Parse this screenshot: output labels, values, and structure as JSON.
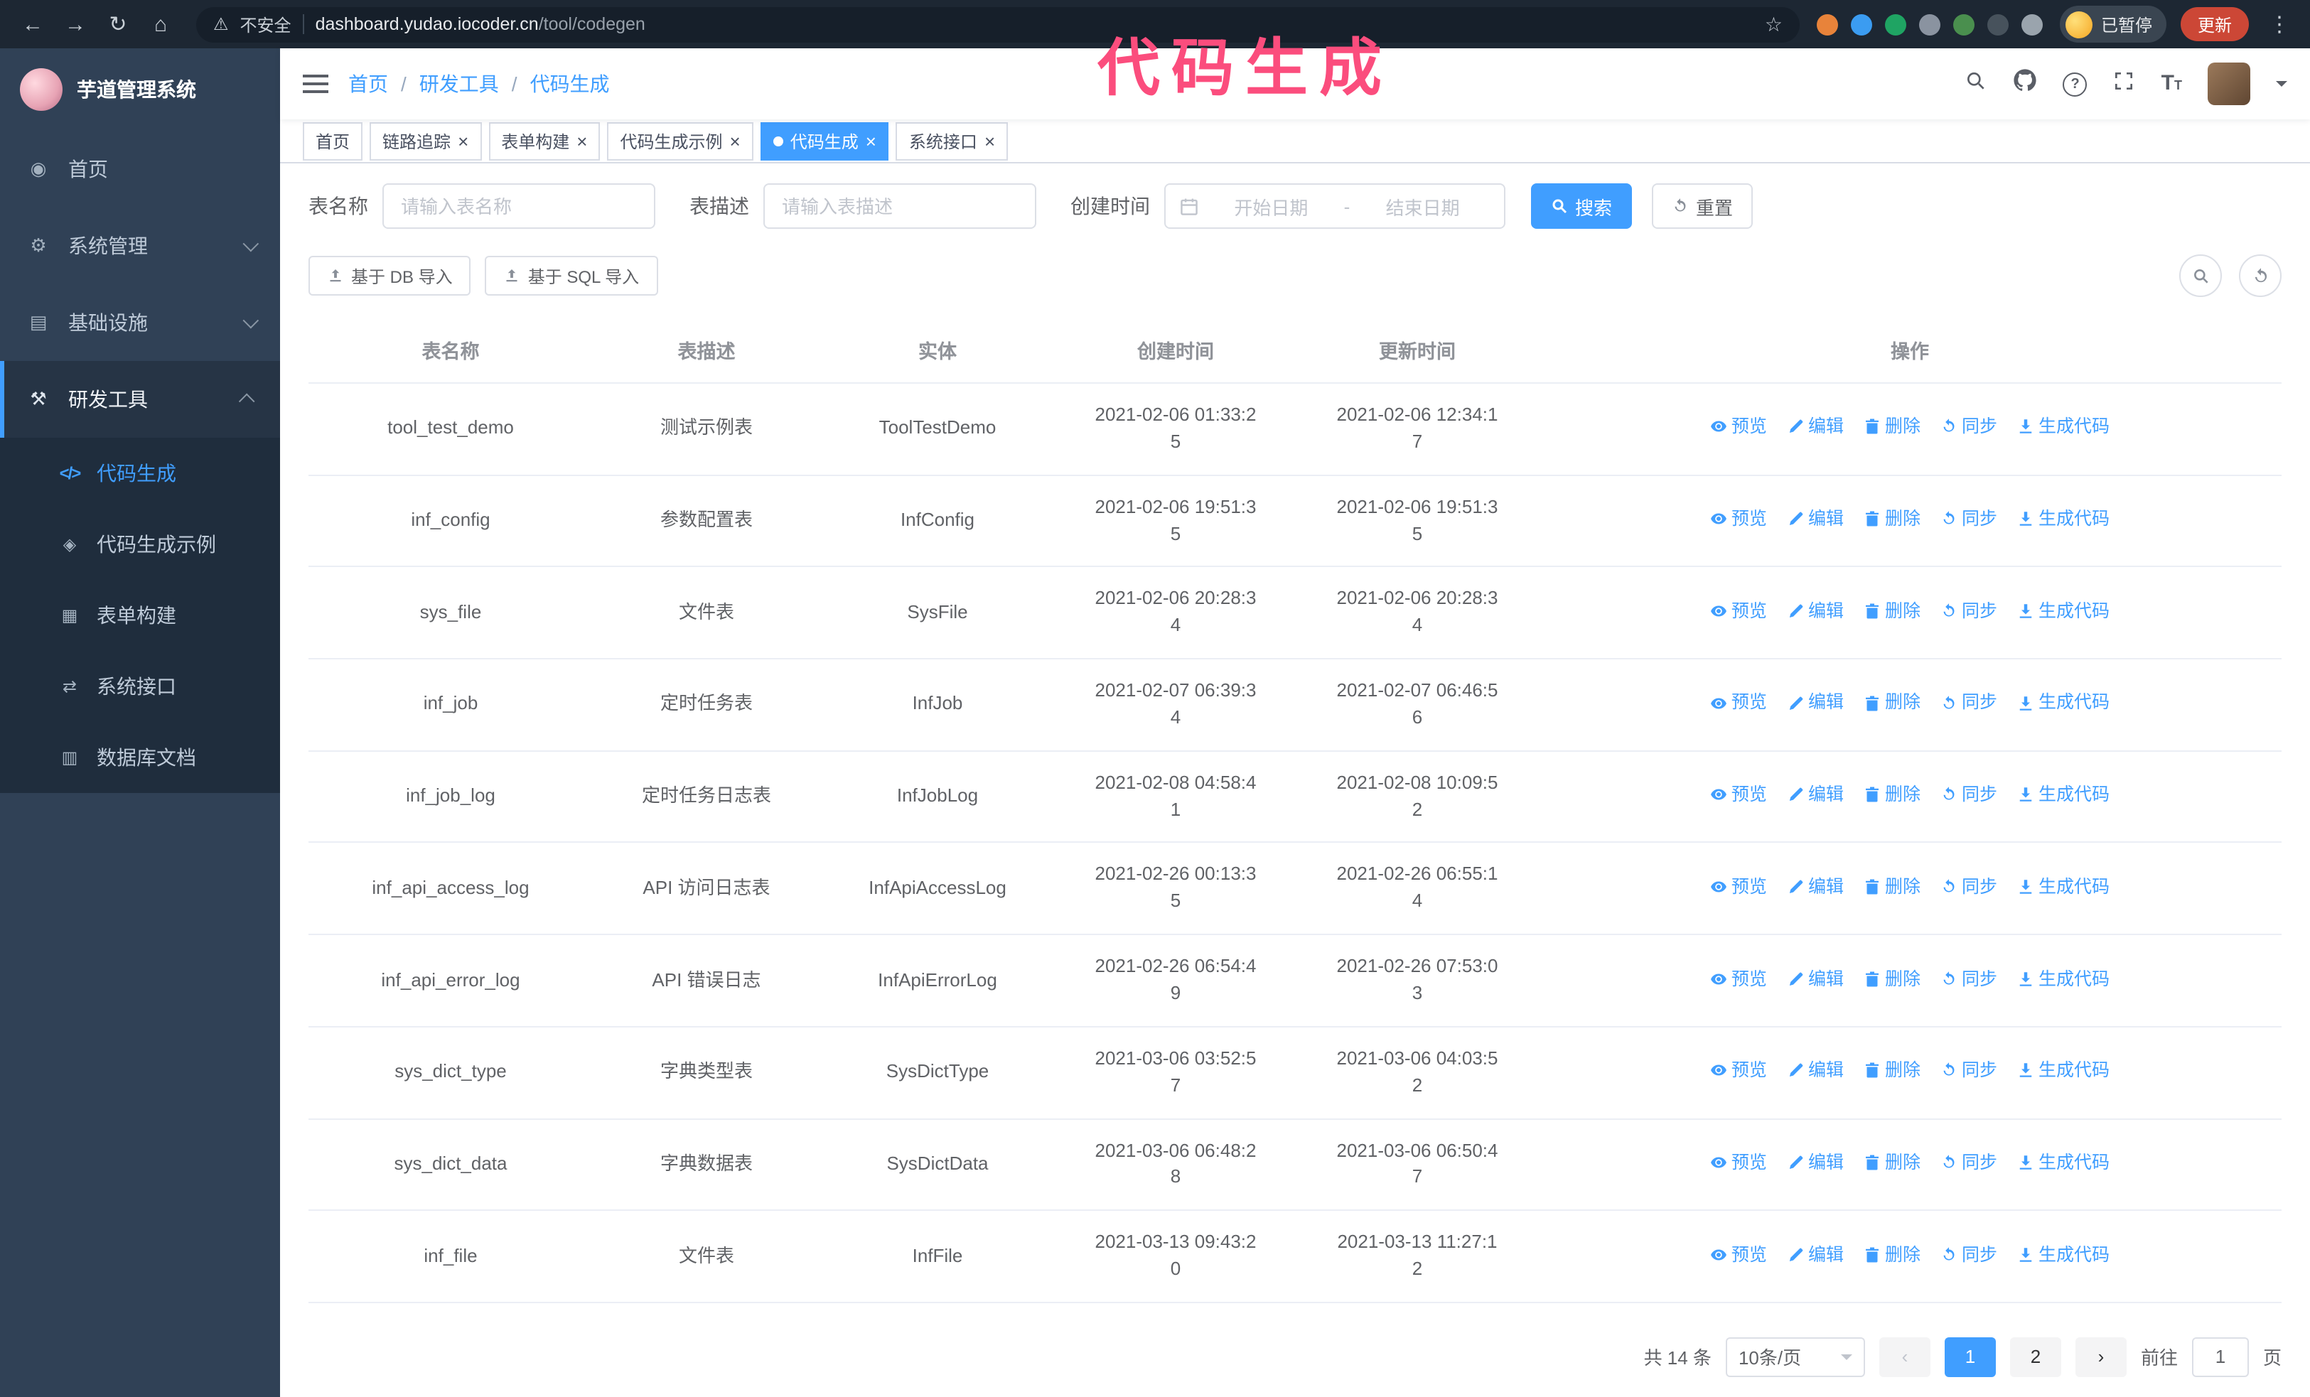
{
  "annotation": {
    "text": "代码生成",
    "color": "#fb4d7d"
  },
  "browser": {
    "security_warning": "不安全",
    "url_host": "dashboard.yudao.iocoder.cn",
    "url_path": "/tool/codegen",
    "profile_label": "已暂停",
    "update_button": "更新",
    "extensions": [
      {
        "name": "extension-orange-icon",
        "color": "#e8833a"
      },
      {
        "name": "extension-blue-drop-icon",
        "color": "#3b9cf1"
      },
      {
        "name": "extension-green-check-icon",
        "color": "#1fa463"
      },
      {
        "name": "extension-people-icon",
        "color": "#8a93a0"
      },
      {
        "name": "extension-green-box-icon",
        "color": "#4a8f4e"
      },
      {
        "name": "extension-dark-icon",
        "color": "#47525c"
      },
      {
        "name": "extension-puzzle-icon",
        "color": "#9aa4ad"
      }
    ]
  },
  "sidebar": {
    "logo_title": "芋道管理系统",
    "menu": [
      {
        "key": "home",
        "label": "首页",
        "icon": "home-icon",
        "type": "item"
      },
      {
        "key": "system-management",
        "label": "系统管理",
        "icon": "gear-icon",
        "type": "group",
        "state": "collapsed"
      },
      {
        "key": "infrastructure",
        "label": "基础设施",
        "icon": "infrastructure-icon",
        "type": "group",
        "state": "collapsed"
      },
      {
        "key": "dev-tools",
        "label": "研发工具",
        "icon": "tools-icon",
        "type": "group",
        "state": "expanded",
        "children": [
          {
            "key": "code-generation",
            "label": "代码生成",
            "icon": "code-icon",
            "active": true
          },
          {
            "key": "code-generation-example",
            "label": "代码生成示例",
            "icon": "example-icon",
            "active": false
          },
          {
            "key": "form-builder",
            "label": "表单构建",
            "icon": "form-icon",
            "active": false
          },
          {
            "key": "system-api",
            "label": "系统接口",
            "icon": "api-icon",
            "active": false
          },
          {
            "key": "database-doc",
            "label": "数据库文档",
            "icon": "database-icon",
            "active": false
          }
        ]
      }
    ]
  },
  "header": {
    "breadcrumb": [
      "首页",
      "研发工具",
      "代码生成"
    ]
  },
  "tabs": [
    {
      "key": "home",
      "label": "首页",
      "closable": false,
      "active": false
    },
    {
      "key": "trace",
      "label": "链路追踪",
      "closable": true,
      "active": false
    },
    {
      "key": "form-builder",
      "label": "表单构建",
      "closable": true,
      "active": false
    },
    {
      "key": "codegen-example",
      "label": "代码生成示例",
      "closable": true,
      "active": false
    },
    {
      "key": "codegen",
      "label": "代码生成",
      "closable": true,
      "active": true
    },
    {
      "key": "system-api",
      "label": "系统接口",
      "closable": true,
      "active": false
    }
  ],
  "filters": {
    "table_name": {
      "label": "表名称",
      "placeholder": "请输入表名称",
      "value": ""
    },
    "table_desc": {
      "label": "表描述",
      "placeholder": "请输入表描述",
      "value": ""
    },
    "create_time": {
      "label": "创建时间",
      "start_placeholder": "开始日期",
      "separator": "-",
      "end_placeholder": "结束日期"
    },
    "search_button": "搜索",
    "reset_button": "重置"
  },
  "toolbar": {
    "import_db": "基于 DB 导入",
    "import_sql": "基于 SQL 导入"
  },
  "table": {
    "columns": [
      "表名称",
      "表描述",
      "实体",
      "创建时间",
      "更新时间",
      "操作"
    ],
    "row_actions": [
      "预览",
      "编辑",
      "删除",
      "同步",
      "生成代码"
    ],
    "rows": [
      {
        "name": "tool_test_demo",
        "description": "测试示例表",
        "entity": "ToolTestDemo",
        "create_time": "2021-02-06 01:33:25",
        "update_time": "2021-02-06 12:34:17"
      },
      {
        "name": "inf_config",
        "description": "参数配置表",
        "entity": "InfConfig",
        "create_time": "2021-02-06 19:51:35",
        "update_time": "2021-02-06 19:51:35"
      },
      {
        "name": "sys_file",
        "description": "文件表",
        "entity": "SysFile",
        "create_time": "2021-02-06 20:28:34",
        "update_time": "2021-02-06 20:28:34"
      },
      {
        "name": "inf_job",
        "description": "定时任务表",
        "entity": "InfJob",
        "create_time": "2021-02-07 06:39:34",
        "update_time": "2021-02-07 06:46:56"
      },
      {
        "name": "inf_job_log",
        "description": "定时任务日志表",
        "entity": "InfJobLog",
        "create_time": "2021-02-08 04:58:41",
        "update_time": "2021-02-08 10:09:52"
      },
      {
        "name": "inf_api_access_log",
        "description": "API 访问日志表",
        "entity": "InfApiAccessLog",
        "create_time": "2021-02-26 00:13:35",
        "update_time": "2021-02-26 06:55:14"
      },
      {
        "name": "inf_api_error_log",
        "description": "API 错误日志",
        "entity": "InfApiErrorLog",
        "create_time": "2021-02-26 06:54:49",
        "update_time": "2021-02-26 07:53:03"
      },
      {
        "name": "sys_dict_type",
        "description": "字典类型表",
        "entity": "SysDictType",
        "create_time": "2021-03-06 03:52:57",
        "update_time": "2021-03-06 04:03:52"
      },
      {
        "name": "sys_dict_data",
        "description": "字典数据表",
        "entity": "SysDictData",
        "create_time": "2021-03-06 06:48:28",
        "update_time": "2021-03-06 06:50:47"
      },
      {
        "name": "inf_file",
        "description": "文件表",
        "entity": "InfFile",
        "create_time": "2021-03-13 09:43:20",
        "update_time": "2021-03-13 11:27:12"
      }
    ]
  },
  "pagination": {
    "total": "共 14 条",
    "page_size": "10条/页",
    "pages": [
      "1",
      "2"
    ],
    "active_page": "1",
    "goto_label": "前往",
    "goto_value": "1",
    "goto_unit": "页"
  },
  "colors": {
    "primary": "#409EFF",
    "sidebar_bg": "#304156",
    "submenu_bg": "#1f2d3d",
    "active_tab_bg": "#409EFF",
    "update_button_bg": "#cc4736"
  }
}
